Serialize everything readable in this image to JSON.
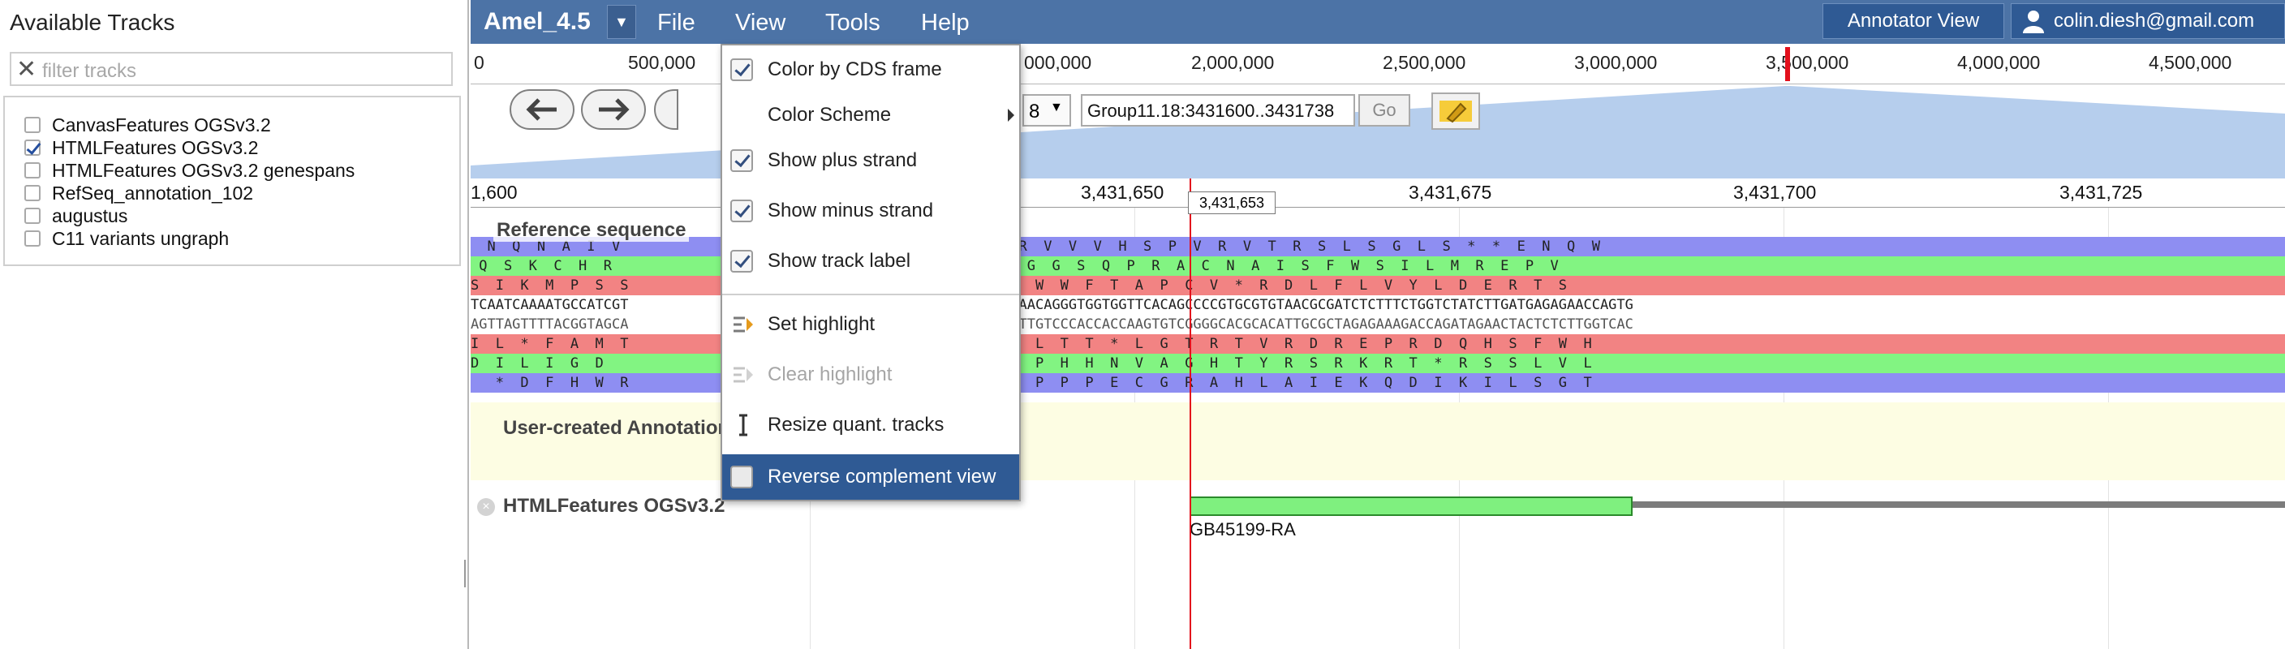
{
  "sidebar": {
    "title": "Available Tracks",
    "filter_placeholder": "filter tracks",
    "tracks": [
      {
        "label": "CanvasFeatures OGSv3.2",
        "checked": false
      },
      {
        "label": "HTMLFeatures OGSv3.2",
        "checked": true
      },
      {
        "label": "HTMLFeatures OGSv3.2 genespans",
        "checked": false
      },
      {
        "label": "RefSeq_annotation_102",
        "checked": false
      },
      {
        "label": "augustus",
        "checked": false
      },
      {
        "label": "C11 variants ungraph",
        "checked": false
      }
    ]
  },
  "menubar": {
    "title": "Amel_4.5",
    "menus": [
      "File",
      "View",
      "Tools",
      "Help"
    ],
    "annotator_view": "Annotator View",
    "user": "colin.diesh@gmail.com"
  },
  "overview": {
    "ticks": [
      "0",
      "500,000",
      "000,000",
      "2,000,000",
      "2,500,000",
      "3,000,000",
      "3,500,000",
      "4,000,000",
      "4,500,000"
    ]
  },
  "navigation": {
    "location": "Group11.18:3431600..3431738",
    "zoom_value": "8",
    "go_label": "Go"
  },
  "ruler": {
    "ticks": [
      "1,600",
      "3,431,650",
      "3,431,675",
      "3,431,700",
      "3,431,725"
    ],
    "cursor_position": "3,431,653"
  },
  "sequence": {
    "label": "Reference sequence",
    "row_fwd_frame1": "  N  Q  N  A  I  V                        A  K  V  K  W  E  N  N  R  V  V  V  H  S  P  V  R  V  T  R  S  L  S  G  L  S  *  *  E  N  Q  W",
    "row_fwd_frame2": " Q  S  K  C  H  R                       R  E  G  K  M  G  K  Q  Q  G  G  S  Q  P  R  A  C  N  A  I  S  F  W  S  I  L  M  R  E  P  V",
    "row_fwd_frame3": "S  I  K  M  P  S  S                      S  R  R  *  N  G  K  T  G  W  W  F  T  A  P  C  V  *  R  D  L  F  L  V  Y  L  D  E  R  T  S",
    "row_dna_fwd": "TCAATCAAAATGCCATCGT                        TCGCGAAGGTAAAATGGGAAAACAACAGGGTGGTGGTTCACAGCCCCGTGCGTGTAACGCGATCTCTTTCTGGTCTATCTTGATGAGAGAACCAGTG",
    "row_dna_rev": "AGTTAGTTTTACGGTAGCA                        AGCGCTTCCATTTTACCCTTTTGTTGTCCCACCACCAAGTGTCGGGGCACGCACATTGCGCTAGAGAAAGACCAGATAGAACTACTCTCTTGGTCAC",
    "row_rev_frame1": "I  L  *  F  A  M  T                      S  A  F  T  F  H  S  F  L  L  T  T  *  L  G  T  R  T  V  R  D  R  E  P  R  D  Q  H  S  F  W  H",
    "row_rev_frame2": "D  I  L  I  G  D                         E  R  L  Y  F  P  F  V  V  P  H  H  N  V  A  G  H  T  Y  R  S  R  K  R  T  *  R  S  S  L  V  L",
    "row_rev_frame3": "   *  D  F  H  W  R                      R  S  P  L  I  P  F  C  C  P  P  P  E  C  G  R  A  H  L  A  I  E  K  Q  D  I  K  I  L  S  G  T"
  },
  "tracks": {
    "user_created": "User-created Annotations",
    "html_track": "HTMLFeatures OGSv3.2",
    "feature_name": "GB45199-RA"
  },
  "view_menu": {
    "items": [
      {
        "label": "Color by CDS frame",
        "type": "check",
        "checked": true
      },
      {
        "label": "Color Scheme",
        "type": "submenu"
      },
      {
        "label": "Show plus strand",
        "type": "check",
        "checked": true
      },
      {
        "label": "Show minus strand",
        "type": "check",
        "checked": true
      },
      {
        "label": "Show track label",
        "type": "check",
        "checked": true
      },
      {
        "label": "Set highlight",
        "type": "icon"
      },
      {
        "label": "Clear highlight",
        "type": "icon",
        "disabled": true
      },
      {
        "label": "Resize quant. tracks",
        "type": "icon"
      },
      {
        "label": "Reverse complement view",
        "type": "check",
        "checked": false,
        "selected": true
      }
    ]
  },
  "colors": {
    "menubar": "#4c73a6",
    "frame_blue": "#8e8ef2",
    "frame_green": "#82f482",
    "frame_red": "#f28383",
    "highlight_line": "#e3101c",
    "menu_selected": "#2f5a94"
  }
}
